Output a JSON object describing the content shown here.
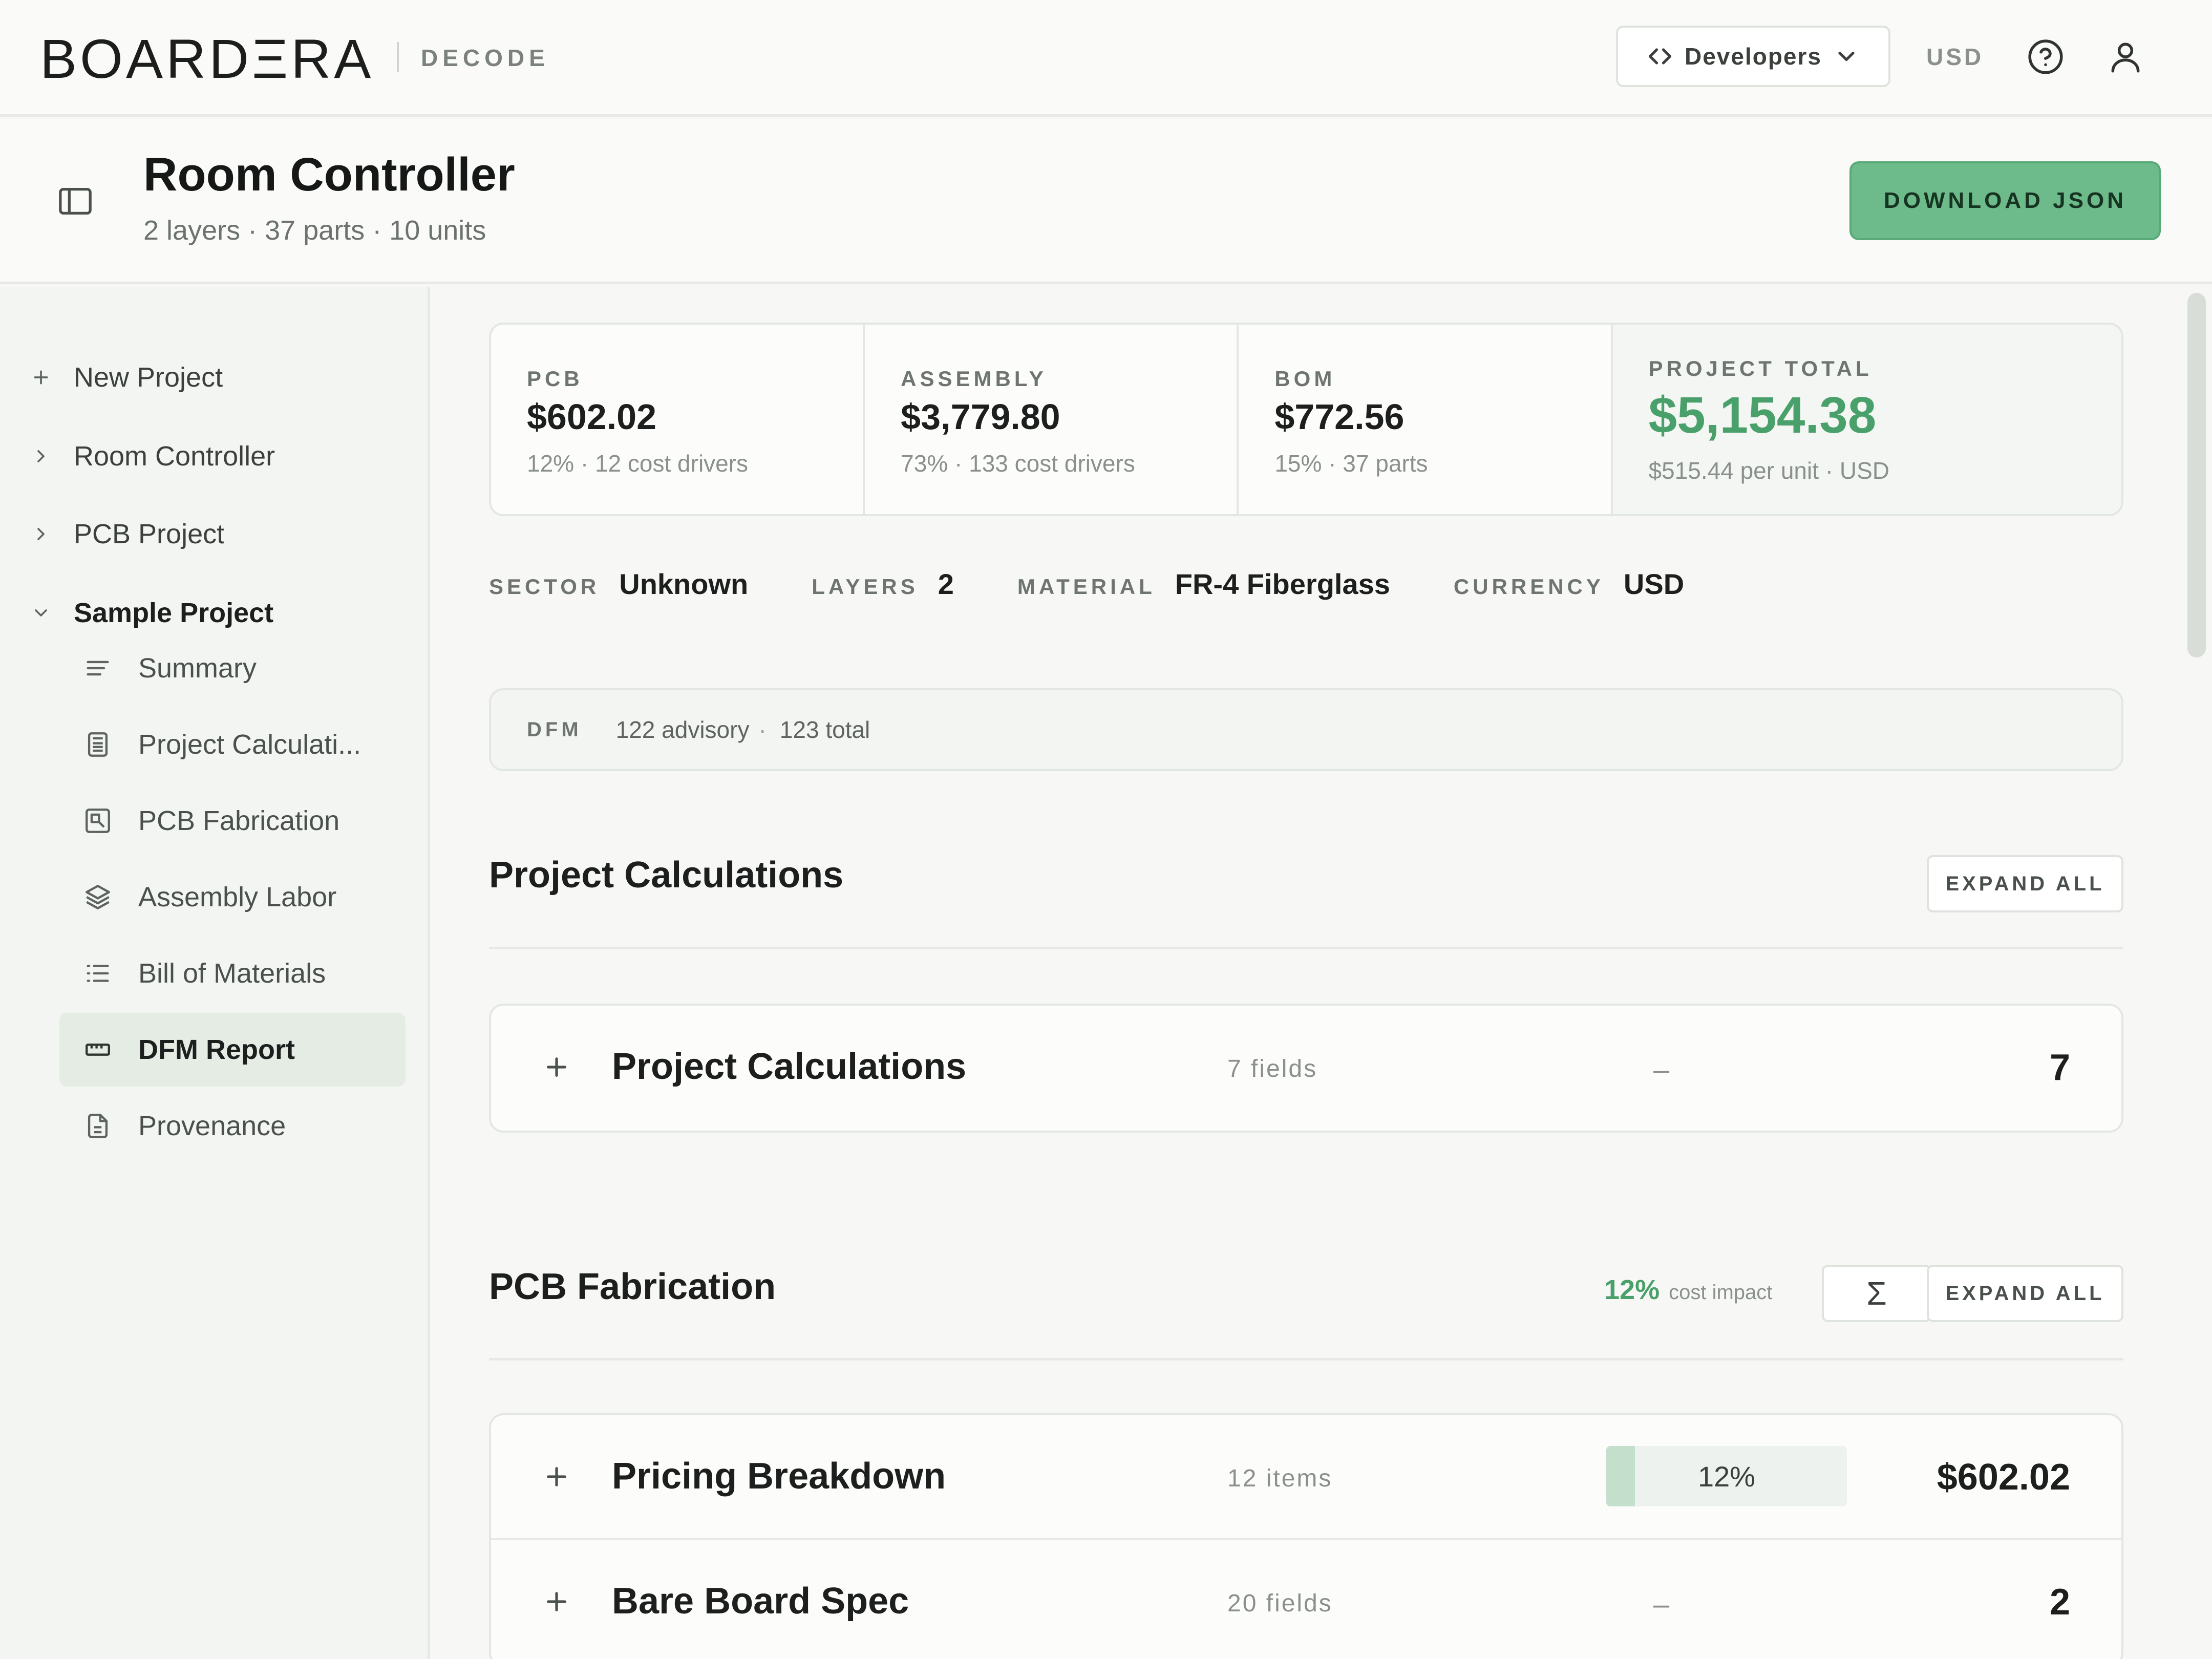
{
  "brand": {
    "logo": "BOARDΞRA",
    "product": "DECODE"
  },
  "topbar": {
    "developers_label": "Developers",
    "currency": "USD"
  },
  "header": {
    "title": "Room Controller",
    "subtitle": "2 layers · 37 parts · 10 units",
    "download_label": "DOWNLOAD JSON"
  },
  "sidebar": {
    "items": [
      {
        "label": "New Project"
      },
      {
        "label": "Room Controller"
      },
      {
        "label": "PCB Project"
      },
      {
        "label": "Sample Project"
      }
    ],
    "sub_items": [
      {
        "label": "Summary",
        "icon": "align-left-icon"
      },
      {
        "label": "Project Calculati...",
        "icon": "calculator-icon"
      },
      {
        "label": "PCB Fabrication",
        "icon": "circuit-board-icon"
      },
      {
        "label": "Assembly Labor",
        "icon": "layers-icon"
      },
      {
        "label": "Bill of Materials",
        "icon": "list-icon"
      },
      {
        "label": "DFM Report",
        "icon": "ruler-icon",
        "active": true
      },
      {
        "label": "Provenance",
        "icon": "file-text-icon"
      }
    ]
  },
  "cards": [
    {
      "label": "PCB",
      "value": "$602.02",
      "note": "12% · 12 cost drivers"
    },
    {
      "label": "ASSEMBLY",
      "value": "$3,779.80",
      "note": "73% · 133 cost drivers"
    },
    {
      "label": "BOM",
      "value": "$772.56",
      "note": "15% · 37 parts"
    },
    {
      "label": "PROJECT TOTAL",
      "value": "$5,154.38",
      "note": "$515.44 per unit · USD"
    }
  ],
  "meta": {
    "sector_key": "SECTOR",
    "sector": "Unknown",
    "layers_key": "LAYERS",
    "layers": "2",
    "material_key": "MATERIAL",
    "material": "FR-4 Fiberglass",
    "currency_key": "CURRENCY",
    "currency": "USD"
  },
  "dfm": {
    "label": "DFM",
    "advisory": "122 advisory",
    "sep": "·",
    "total": "123 total"
  },
  "sections": {
    "calc": {
      "title": "Project Calculations",
      "expand_label": "EXPAND ALL",
      "rows": [
        {
          "name": "Project Calculations",
          "count": "7 fields",
          "share": "–",
          "value": "7"
        }
      ]
    },
    "pcb": {
      "title": "PCB Fabrication",
      "impact_value": "12%",
      "impact_label": "cost impact",
      "sigma": "Σ",
      "expand_label": "EXPAND ALL",
      "rows": [
        {
          "name": "Pricing Breakdown",
          "count": "12 items",
          "share": "12%",
          "share_fraction": 0.12,
          "value": "$602.02"
        },
        {
          "name": "Bare Board Spec",
          "count": "20 fields",
          "share": "–",
          "value": "2"
        }
      ]
    }
  },
  "colors": {
    "accent": "#4aa06a",
    "button": "#6dbb8a",
    "active_nav": "#e4ece4"
  }
}
